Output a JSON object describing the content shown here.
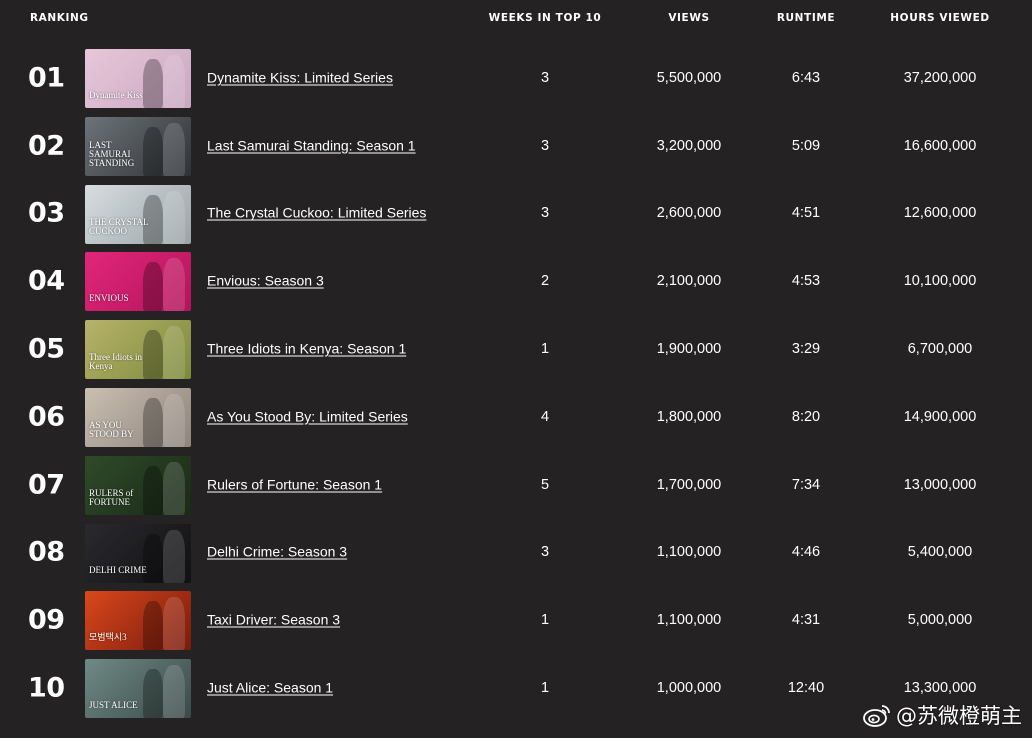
{
  "headers": {
    "ranking": "RANKING",
    "weeks": "WEEKS IN TOP 10",
    "views": "VIEWS",
    "runtime": "RUNTIME",
    "hours": "HOURS VIEWED"
  },
  "rows": [
    {
      "rank": "01",
      "title": "Dynamite Kiss: Limited Series",
      "weeks": "3",
      "views": "5,500,000",
      "runtime": "6:43",
      "hours": "37,200,000",
      "thumb_text": "Dynamite Kiss",
      "thumb_colors": [
        "#e9c7d9",
        "#c9a7c2"
      ]
    },
    {
      "rank": "02",
      "title": "Last Samurai Standing: Season 1",
      "weeks": "3",
      "views": "3,200,000",
      "runtime": "5:09",
      "hours": "16,600,000",
      "thumb_text": "LAST SAMURAI STANDING",
      "thumb_colors": [
        "#6e7379",
        "#2f3337"
      ]
    },
    {
      "rank": "03",
      "title": "The Crystal Cuckoo: Limited Series",
      "weeks": "3",
      "views": "2,600,000",
      "runtime": "4:51",
      "hours": "12,600,000",
      "thumb_text": "THE CRYSTAL CUCKOO",
      "thumb_colors": [
        "#d8dde0",
        "#9aa4a8"
      ]
    },
    {
      "rank": "04",
      "title": "Envious: Season 3",
      "weeks": "2",
      "views": "2,100,000",
      "runtime": "4:53",
      "hours": "10,100,000",
      "thumb_text": "ENVIOUS",
      "thumb_colors": [
        "#e3267a",
        "#b3145c"
      ]
    },
    {
      "rank": "05",
      "title": "Three Idiots in Kenya: Season 1",
      "weeks": "1",
      "views": "1,900,000",
      "runtime": "3:29",
      "hours": "6,700,000",
      "thumb_text": "Three Idiots in Kenya",
      "thumb_colors": [
        "#b7b36a",
        "#7c8a3c"
      ]
    },
    {
      "rank": "06",
      "title": "As You Stood By: Limited Series",
      "weeks": "4",
      "views": "1,800,000",
      "runtime": "8:20",
      "hours": "14,900,000",
      "thumb_text": "AS YOU STOOD BY",
      "thumb_colors": [
        "#c9bfb2",
        "#8e847c"
      ]
    },
    {
      "rank": "07",
      "title": "Rulers of Fortune: Season 1",
      "weeks": "5",
      "views": "1,700,000",
      "runtime": "7:34",
      "hours": "13,000,000",
      "thumb_text": "RULERS of FORTUNE",
      "thumb_colors": [
        "#2f4a2a",
        "#1a2a17"
      ]
    },
    {
      "rank": "08",
      "title": "Delhi Crime: Season 3",
      "weeks": "3",
      "views": "1,100,000",
      "runtime": "4:46",
      "hours": "5,400,000",
      "thumb_text": "DELHI CRIME",
      "thumb_colors": [
        "#2a2a2e",
        "#111114"
      ]
    },
    {
      "rank": "09",
      "title": "Taxi Driver: Season 3",
      "weeks": "1",
      "views": "1,100,000",
      "runtime": "4:31",
      "hours": "5,000,000",
      "thumb_text": "모범택시3",
      "thumb_colors": [
        "#d9481c",
        "#7a1a0c"
      ]
    },
    {
      "rank": "10",
      "title": "Just Alice: Season 1",
      "weeks": "1",
      "views": "1,000,000",
      "runtime": "12:40",
      "hours": "13,300,000",
      "thumb_text": "JUST ALICE",
      "thumb_colors": [
        "#6f8a86",
        "#3b4a48"
      ]
    }
  ],
  "watermark": {
    "text": "@苏微橙萌主",
    "icon": "weibo-icon"
  }
}
